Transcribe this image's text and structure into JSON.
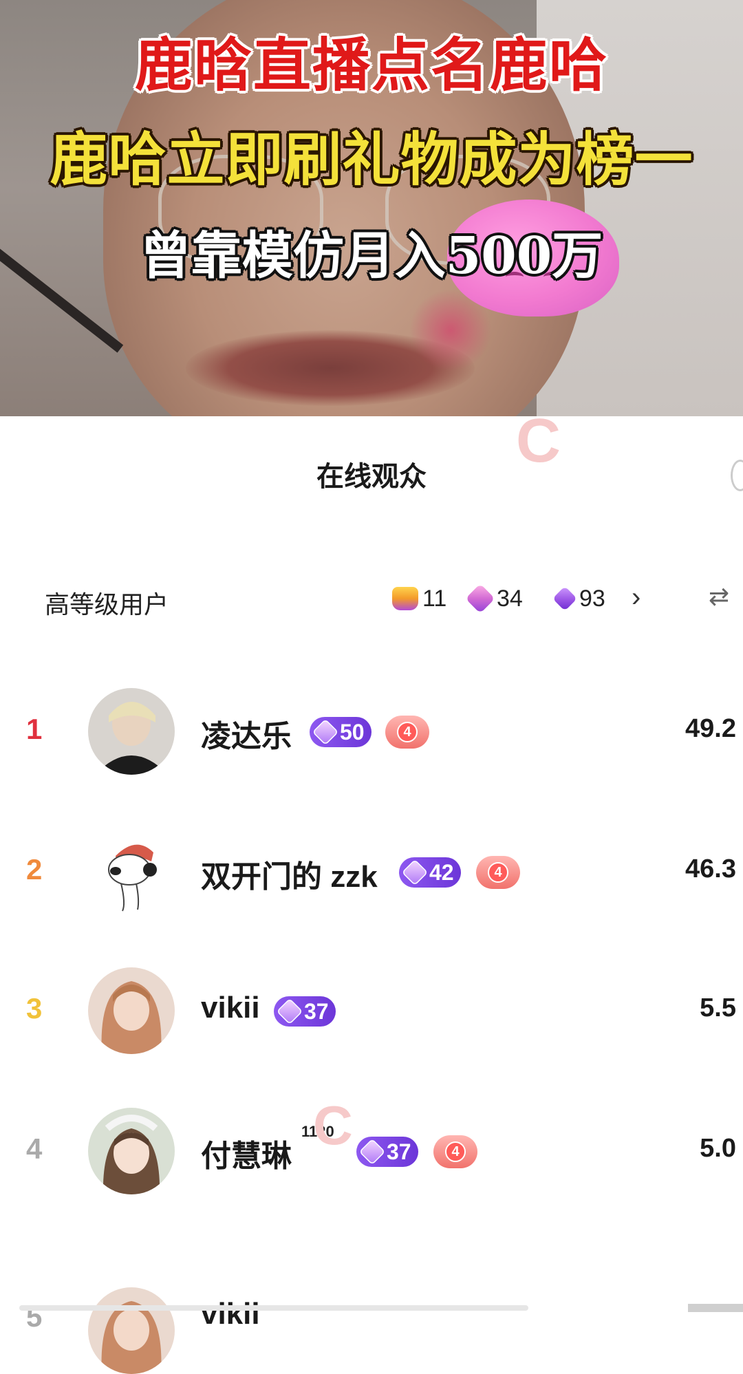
{
  "video": {
    "caption_line1": "鹿晗直播点名鹿哈",
    "caption_line2": "鹿哈立即刷礼物成为榜一",
    "caption_line3": "曾靠模仿月入500万"
  },
  "panel": {
    "title": "在线观众",
    "section_label": "高等级用户",
    "stats": [
      {
        "icon": "crown-badge-icon",
        "value": "11"
      },
      {
        "icon": "pink-hexagon-badge-icon",
        "value": "34"
      },
      {
        "icon": "purple-hexagon-badge-icon",
        "value": "93"
      }
    ],
    "watermark": "C"
  },
  "users": [
    {
      "rank": "1",
      "name": "凌达乐",
      "level": "50",
      "fan_level": "4",
      "score": "49.2",
      "rank_color": "#e0313f"
    },
    {
      "rank": "2",
      "name": "双开门的 zzk",
      "level": "42",
      "fan_level": "4",
      "score": "46.3",
      "rank_color": "#f08a3c"
    },
    {
      "rank": "3",
      "name": "vikii",
      "level": "37",
      "fan_level": "",
      "score": "5.5",
      "rank_color": "#f1c23a"
    },
    {
      "rank": "4",
      "name": "付慧琳",
      "superscript": "1120",
      "level": "37",
      "fan_level": "4",
      "score": "5.0",
      "rank_color": "#aaaaaa"
    },
    {
      "rank": "5",
      "name": "vikii",
      "level": "",
      "fan_level": "",
      "score": "",
      "rank_color": "#aaaaaa"
    }
  ],
  "colors": {
    "level_badge": "#7a45e2",
    "fan_badge": "#f1726c",
    "caption_red": "#e01919",
    "caption_yellow": "#f4e13a"
  }
}
